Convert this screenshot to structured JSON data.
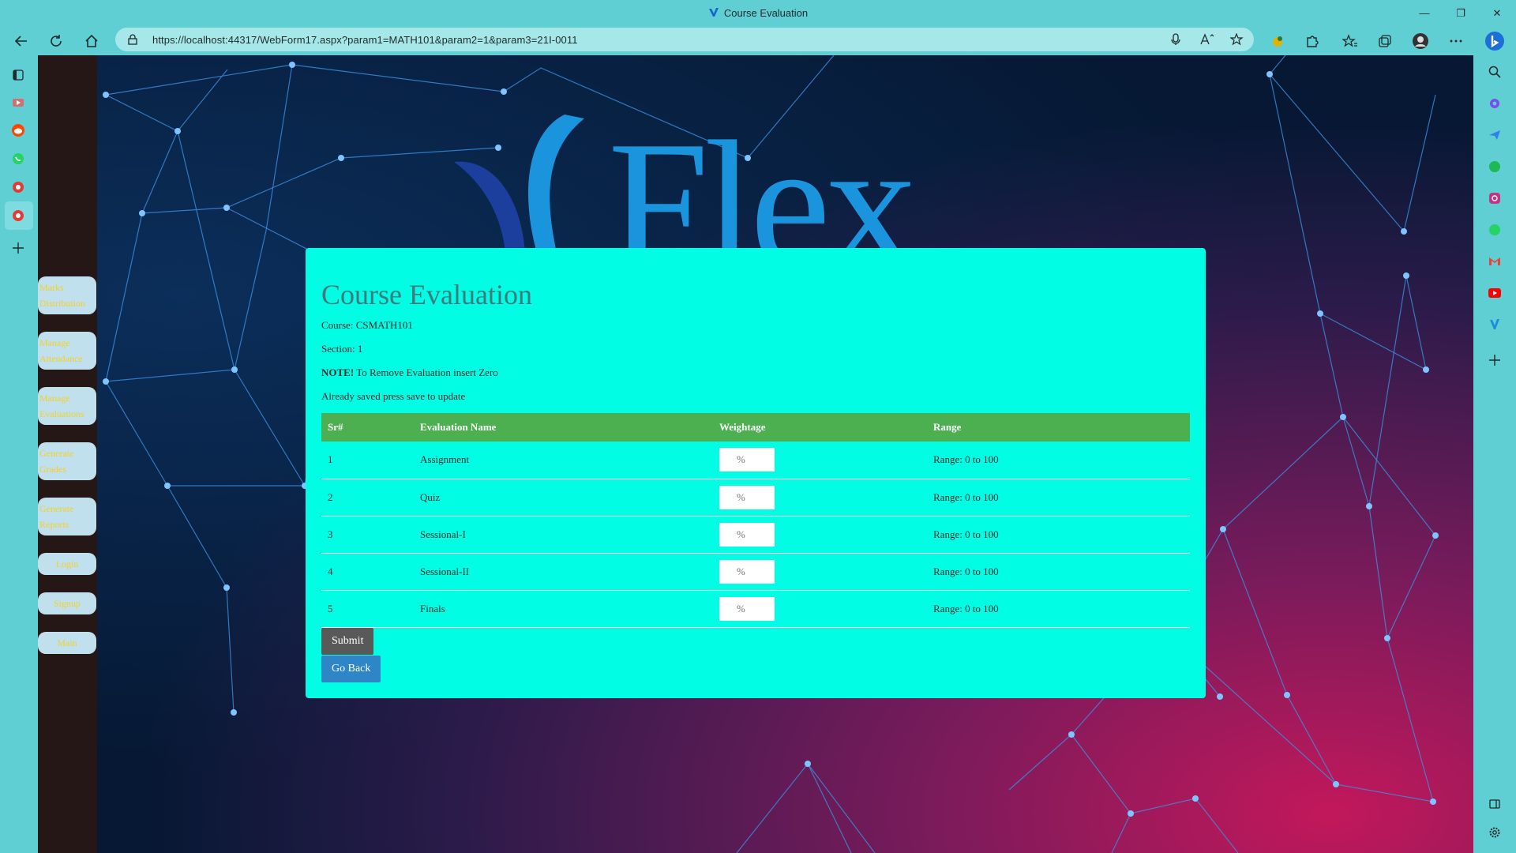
{
  "browser": {
    "window_title": "Course Evaluation",
    "url": "https://localhost:44317/WebForm17.aspx?param1=MATH101&param2=1&param3=21I-0011"
  },
  "app_sidebar": {
    "items": [
      {
        "label": "Marks Distribution"
      },
      {
        "label": "Manage Attendance"
      },
      {
        "label": "Manage Evaluations"
      },
      {
        "label": "Generate Grades"
      },
      {
        "label": "Generate Reports"
      },
      {
        "label": "Login"
      },
      {
        "label": "Signup"
      },
      {
        "label": "Main"
      }
    ]
  },
  "logo": {
    "text": "Flex"
  },
  "page": {
    "title": "Course Evaluation",
    "course_line": "Course: CSMATH101",
    "section_line": "Section: 1",
    "note_label": "NOTE!",
    "note_text": " To Remove Evaluation insert Zero",
    "status_line": "Already saved press save to update",
    "table": {
      "headers": [
        "Sr#",
        "Evaluation Name",
        "Weightage",
        "Range"
      ],
      "rows": [
        {
          "sr": "1",
          "name": "Assignment",
          "weight": "%",
          "range": "Range: 0 to 100"
        },
        {
          "sr": "2",
          "name": "Quiz",
          "weight": "%",
          "range": "Range: 0 to 100"
        },
        {
          "sr": "3",
          "name": "Sessional-I",
          "weight": "%",
          "range": "Range: 0 to 100"
        },
        {
          "sr": "4",
          "name": "Sessional-II",
          "weight": "%",
          "range": "Range: 0 to 100"
        },
        {
          "sr": "5",
          "name": "Finals",
          "weight": "%",
          "range": "Range: 0 to 100"
        }
      ]
    },
    "submit_label": "Submit",
    "back_label": "Go Back"
  },
  "colors": {
    "browser_chrome": "#5fcfd3",
    "panel_bg": "#00fde4",
    "table_header": "#4caf50",
    "nav_button_bg": "#bfe0ec",
    "nav_button_text": "#f3d02c",
    "submit_bg": "#595959",
    "back_bg": "#2e86c6"
  }
}
